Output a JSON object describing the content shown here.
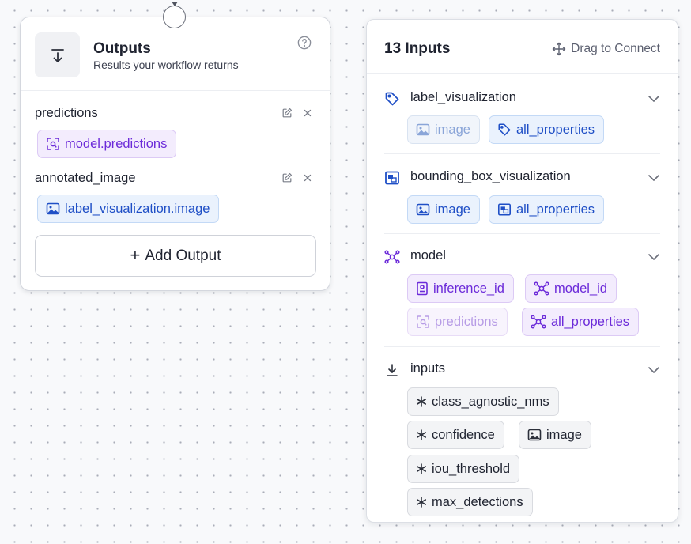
{
  "outputs": {
    "title": "Outputs",
    "subtitle": "Results your workflow returns",
    "rows": [
      {
        "label": "predictions",
        "chip": "model.predictions"
      },
      {
        "label": "annotated_image",
        "chip": "label_visualization.image"
      }
    ],
    "add_button": "Add Output"
  },
  "inputs_panel": {
    "title": "13 Inputs",
    "drag_hint": "Drag to Connect",
    "groups": [
      {
        "label": "label_visualization",
        "chips": [
          "image",
          "all_properties"
        ]
      },
      {
        "label": "bounding_box_visualization",
        "chips": [
          "image",
          "all_properties"
        ]
      },
      {
        "label": "model",
        "chips": [
          "inference_id",
          "model_id",
          "predictions",
          "all_properties"
        ]
      },
      {
        "label": "inputs",
        "chips": [
          "class_agnostic_nms",
          "confidence",
          "image",
          "iou_threshold",
          "max_detections"
        ]
      }
    ]
  },
  "colors": {
    "purple_accent": "#6c2bd9",
    "blue_accent": "#1f4fc6",
    "canvas_background": "#f8f9fb"
  }
}
